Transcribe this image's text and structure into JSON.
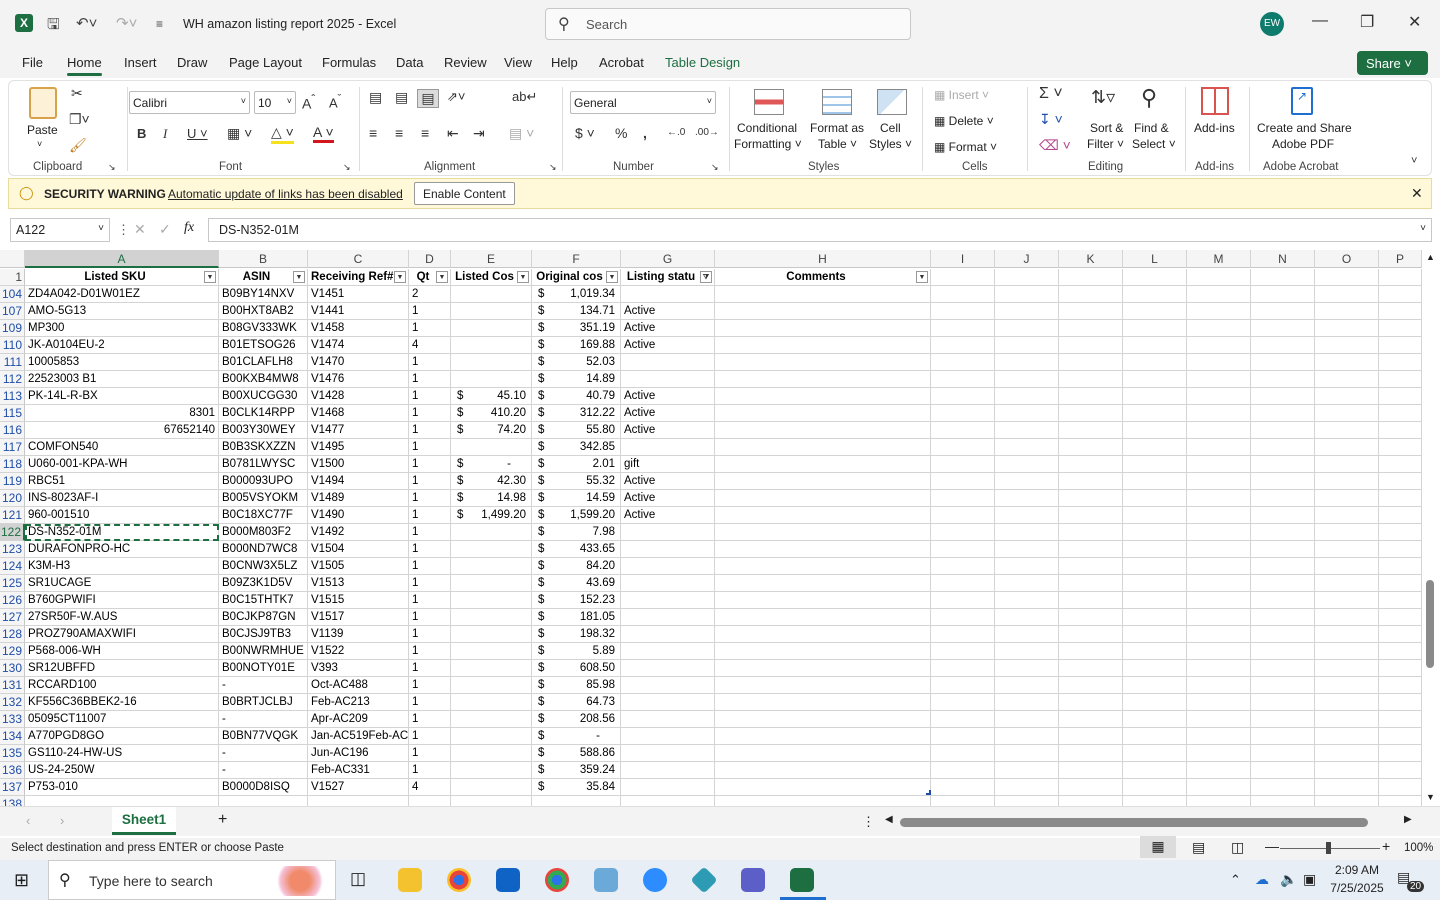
{
  "window": {
    "title": "WH amazon listing report 2025  -  Excel",
    "avatar": "EW",
    "search_placeholder": "Search"
  },
  "menu": [
    "File",
    "Home",
    "Insert",
    "Draw",
    "Page Layout",
    "Formulas",
    "Data",
    "Review",
    "View",
    "Help",
    "Acrobat",
    "Table Design"
  ],
  "share_label": "Share",
  "ribbon": {
    "paste": "Paste",
    "font_name": "Calibri",
    "font_size": "10",
    "number_format": "General",
    "conditional": "Conditional",
    "formatting": "Formatting",
    "format_as": "Format as",
    "table": "Table",
    "cell": "Cell",
    "styles": "Styles",
    "insert": "Insert",
    "delete": "Delete",
    "format": "Format",
    "sort": "Sort &",
    "filter": "Filter",
    "find": "Find &",
    "select": "Select",
    "addins": "Add-ins",
    "create_share": "Create and Share",
    "adobe_pdf": "Adobe PDF",
    "groups": {
      "clipboard": "Clipboard",
      "font": "Font",
      "alignment": "Alignment",
      "number": "Number",
      "styles": "Styles",
      "cells": "Cells",
      "editing": "Editing",
      "addins": "Add-ins",
      "acrobat": "Adobe Acrobat"
    }
  },
  "warning": {
    "title": "SECURITY WARNING",
    "message": "Automatic update of links has been disabled",
    "button": "Enable Content"
  },
  "formula": {
    "name_box": "A122",
    "fx": "fx",
    "content": "DS-N352-01M"
  },
  "columns": [
    "A",
    "B",
    "C",
    "D",
    "E",
    "F",
    "G",
    "H",
    "I",
    "J",
    "K",
    "L",
    "M",
    "N",
    "O",
    "P"
  ],
  "headers": [
    "Listed SKU",
    "ASIN",
    "Receiving Ref#",
    "Qt",
    "Listed Cos",
    "Original cos",
    "Listing statu",
    "Comments"
  ],
  "rows": [
    {
      "n": "104",
      "a": "ZD4A042-D01W01EZ",
      "b": "B09BY14NXV",
      "c": "V1451",
      "d": "2",
      "e": "",
      "f": "1,019.34",
      "g": ""
    },
    {
      "n": "107",
      "a": "AMO-5G13",
      "b": "B00HXT8AB2",
      "c": "V1441",
      "d": "1",
      "e": "",
      "f": "134.71",
      "g": "Active"
    },
    {
      "n": "109",
      "a": "MP300",
      "b": "B08GV333WK",
      "c": "V1458",
      "d": "1",
      "e": "",
      "f": "351.19",
      "g": "Active"
    },
    {
      "n": "110",
      "a": "JK-A0104EU-2",
      "b": "B01ETSOG26",
      "c": "V1474",
      "d": "4",
      "e": "",
      "f": "169.88",
      "g": "Active"
    },
    {
      "n": "111",
      "a": "10005853",
      "b": "B01CLAFLH8",
      "c": "V1470",
      "d": "1",
      "e": "",
      "f": "52.03",
      "g": ""
    },
    {
      "n": "112",
      "a": "22523003 B1",
      "b": "B00KXB4MW8",
      "c": "V1476",
      "d": "1",
      "e": "",
      "f": "14.89",
      "g": ""
    },
    {
      "n": "113",
      "a": "PK-14L-R-BX",
      "b": "B00XUCGG30",
      "c": "V1428",
      "d": "1",
      "e": "45.10",
      "f": "40.79",
      "g": "Active"
    },
    {
      "n": "115",
      "a": "8301",
      "a_num": true,
      "b": "B0CLK14RPP",
      "c": "V1468",
      "d": "1",
      "e": "410.20",
      "f": "312.22",
      "g": "Active"
    },
    {
      "n": "116",
      "a": "67652140",
      "a_num": true,
      "b": "B003Y30WEY",
      "c": "V1477",
      "d": "1",
      "e": "74.20",
      "f": "55.80",
      "g": "Active"
    },
    {
      "n": "117",
      "a": "COMFON540",
      "b": "B0B3SKXZZN",
      "c": "V1495",
      "d": "1",
      "e": "",
      "f": "342.85",
      "g": ""
    },
    {
      "n": "118",
      "a": "U060-001-KPA-WH",
      "b": "B0781LWYSC",
      "c": "V1500",
      "d": "1",
      "e": "-",
      "f": "2.01",
      "g": "gift"
    },
    {
      "n": "119",
      "a": "RBC51",
      "b": "B000093UPO",
      "c": "V1494",
      "d": "1",
      "e": "42.30",
      "f": "55.32",
      "g": "Active"
    },
    {
      "n": "120",
      "a": "INS-8023AF-I",
      "b": "B005VSYOKM",
      "c": "V1489",
      "d": "1",
      "e": "14.98",
      "f": "14.59",
      "g": "Active"
    },
    {
      "n": "121",
      "a": "960-001510",
      "b": "B0C18XC77F",
      "c": "V1490",
      "d": "1",
      "e": "1,499.20",
      "f": "1,599.20",
      "g": "Active"
    },
    {
      "n": "122",
      "a": "DS-N352-01M",
      "b": "B000M803F2",
      "c": "V1492",
      "d": "1",
      "e": "",
      "f": "7.98",
      "g": ""
    },
    {
      "n": "123",
      "a": "DURAFONPRO-HC",
      "b": "B000ND7WC8",
      "c": "V1504",
      "d": "1",
      "e": "",
      "f": "433.65",
      "g": ""
    },
    {
      "n": "124",
      "a": "K3M-H3",
      "b": "B0CNW3X5LZ",
      "c": "V1505",
      "d": "1",
      "e": "",
      "f": "84.20",
      "g": ""
    },
    {
      "n": "125",
      "a": "SR1UCAGE",
      "b": "B09Z3K1D5V",
      "c": "V1513",
      "d": "1",
      "e": "",
      "f": "43.69",
      "g": ""
    },
    {
      "n": "126",
      "a": "B760GPWIFI",
      "b": "B0C15THTK7",
      "c": "V1515",
      "d": "1",
      "e": "",
      "f": "152.23",
      "g": ""
    },
    {
      "n": "127",
      "a": "27SR50F-W.AUS",
      "b": "B0CJKP87GN",
      "c": "V1517",
      "d": "1",
      "e": "",
      "f": "181.05",
      "g": ""
    },
    {
      "n": "128",
      "a": "PROZ790AMAXWIFI",
      "b": "B0CJSJ9TB3",
      "c": "V1139",
      "d": "1",
      "e": "",
      "f": "198.32",
      "g": ""
    },
    {
      "n": "129",
      "a": "P568-006-WH",
      "b": "B00NWRMHUE",
      "c": "V1522",
      "d": "1",
      "e": "",
      "f": "5.89",
      "g": ""
    },
    {
      "n": "130",
      "a": "SR12UBFFD",
      "b": "B00NOTY01E",
      "c": "V393",
      "d": "1",
      "e": "",
      "f": "608.50",
      "g": ""
    },
    {
      "n": "131",
      "a": "RCCARD100",
      "b": "-",
      "c": "Oct-AC488",
      "d": "1",
      "e": "",
      "f": "85.98",
      "g": ""
    },
    {
      "n": "132",
      "a": "KF556C36BBEK2-16",
      "b": "B0BRTJCLBJ",
      "c": "Feb-AC213",
      "d": "1",
      "e": "",
      "f": "64.73",
      "g": ""
    },
    {
      "n": "133",
      "a": "05095CT11007",
      "b": "-",
      "c": "Apr-AC209",
      "d": "1",
      "e": "",
      "f": "208.56",
      "g": ""
    },
    {
      "n": "134",
      "a": "A770PGD8GO",
      "b": "B0BN77VQGK",
      "c": "Jan-AC519Feb-AC4",
      "d": "1",
      "e": "",
      "f": "-",
      "g": ""
    },
    {
      "n": "135",
      "a": "GS110-24-HW-US",
      "b": "-",
      "c": "Jun-AC196",
      "d": "1",
      "e": "",
      "f": "588.86",
      "g": ""
    },
    {
      "n": "136",
      "a": "US-24-250W",
      "b": "-",
      "c": "Feb-AC331",
      "d": "1",
      "e": "",
      "f": "359.24",
      "g": ""
    },
    {
      "n": "137",
      "a": "P753-010",
      "b": "B0000D8ISQ",
      "c": "V1527",
      "d": "4",
      "e": "",
      "f": "35.84",
      "g": ""
    },
    {
      "n": "138",
      "a": "",
      "b": "",
      "c": "",
      "d": "",
      "e": "",
      "f": "",
      "g": ""
    }
  ],
  "sheet_tab": "Sheet1",
  "status": {
    "message": "Select destination and press ENTER or choose Paste",
    "zoom": "100%"
  },
  "taskbar": {
    "search": "Type here to search",
    "time": "2:09 AM",
    "date": "7/25/2025",
    "notif": "20"
  }
}
